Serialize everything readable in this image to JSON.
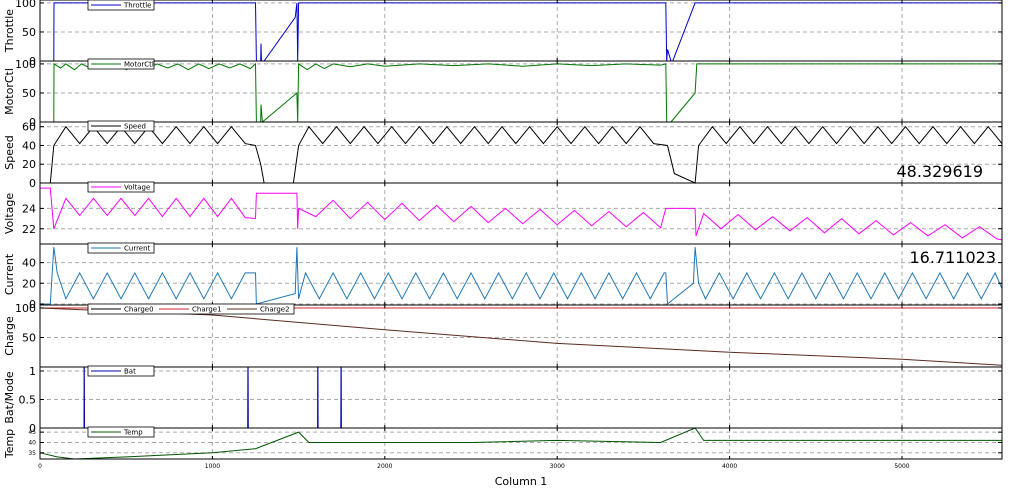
{
  "chart_data": {
    "type": "line",
    "xlabel": "Column 1",
    "xlim": [
      0,
      5580
    ],
    "xticks": [
      {
        "v": 0,
        "label": "0"
      },
      {
        "v": 1000,
        "label": "1000"
      },
      {
        "v": 2000,
        "label": "2000"
      },
      {
        "v": 3000,
        "label": "3000"
      },
      {
        "v": 4000,
        "label": "4000"
      },
      {
        "v": 5000,
        "label": "5000"
      }
    ],
    "grid": true,
    "panels": [
      {
        "ylabel": "Throttle",
        "ylim": [
          0,
          105
        ],
        "yticks": [
          {
            "v": 0,
            "label": "0"
          },
          {
            "v": 50,
            "label": "50"
          },
          {
            "v": 100,
            "label": "100"
          }
        ],
        "series": [
          {
            "name": "Throttle",
            "color": "#0000cc",
            "x": [
              0,
              80,
              81,
              1250,
              1255,
              1280,
              1282,
              1285,
              1290,
              1300,
              1480,
              1490,
              1495,
              1500,
              3630,
              3635,
              3640,
              3660,
              3670,
              3800,
              5580
            ],
            "y": [
              0,
              0,
              100,
              100,
              0,
              0,
              30,
              0,
              0,
              0,
              75,
              100,
              0,
              100,
              100,
              0,
              20,
              0,
              0,
              100,
              100
            ]
          }
        ]
      },
      {
        "ylabel": "MotorCtl",
        "ylim": [
          0,
          105
        ],
        "yticks": [
          {
            "v": 0,
            "label": "0"
          },
          {
            "v": 50,
            "label": "50"
          },
          {
            "v": 100,
            "label": "100"
          }
        ],
        "series": [
          {
            "name": "MotorCtl",
            "color": "#007700",
            "x": [
              0,
              80,
              81,
              120,
              150,
              200,
              240,
              300,
              350,
              400,
              450,
              500,
              560,
              620,
              680,
              740,
              800,
              860,
              920,
              980,
              1040,
              1100,
              1160,
              1220,
              1250,
              1255,
              1280,
              1282,
              1290,
              1490,
              1495,
              1500,
              1550,
              1600,
              1650,
              1700,
              1800,
              1900,
              2000,
              2200,
              2400,
              2600,
              2800,
              3000,
              3200,
              3400,
              3600,
              3630,
              3635,
              3660,
              3800,
              3810,
              4000,
              4500,
              5000,
              5580
            ],
            "y": [
              0,
              0,
              100,
              93,
              100,
              90,
              100,
              92,
              100,
              94,
              100,
              90,
              100,
              92,
              100,
              93,
              100,
              90,
              100,
              92,
              100,
              93,
              100,
              92,
              100,
              0,
              0,
              30,
              0,
              50,
              0,
              100,
              90,
              100,
              92,
              100,
              95,
              100,
              96,
              100,
              97,
              100,
              96,
              100,
              97,
              100,
              98,
              100,
              0,
              0,
              50,
              100,
              100,
              100,
              100,
              100
            ]
          }
        ]
      },
      {
        "ylabel": "Speed",
        "ylim": [
          0,
          65
        ],
        "yticks": [
          {
            "v": 0,
            "label": "0"
          },
          {
            "v": 20,
            "label": "20"
          },
          {
            "v": 40,
            "label": "40"
          },
          {
            "v": 60,
            "label": "60"
          }
        ],
        "series": [
          {
            "name": "Speed",
            "color": "#000000",
            "x": [
              0,
              60,
              80,
              150,
              230,
              310,
              390,
              470,
              550,
              630,
              710,
              790,
              870,
              950,
              1030,
              1110,
              1190,
              1250,
              1280,
              1300,
              1470,
              1500,
              1560,
              1640,
              1720,
              1800,
              1880,
              1960,
              2040,
              2120,
              2200,
              2280,
              2360,
              2440,
              2520,
              2600,
              2680,
              2760,
              2840,
              2920,
              3000,
              3080,
              3160,
              3240,
              3320,
              3400,
              3480,
              3560,
              3640,
              3680,
              3800,
              3820,
              3900,
              3980,
              4060,
              4140,
              4220,
              4300,
              4380,
              4460,
              4540,
              4620,
              4700,
              4780,
              4860,
              4940,
              5020,
              5100,
              5180,
              5260,
              5340,
              5420,
              5500,
              5580
            ],
            "y": [
              0,
              0,
              40,
              60,
              42,
              60,
              42,
              60,
              42,
              60,
              42,
              60,
              42,
              60,
              42,
              60,
              42,
              40,
              20,
              0,
              0,
              40,
              60,
              42,
              60,
              42,
              60,
              42,
              60,
              42,
              60,
              42,
              60,
              42,
              60,
              42,
              60,
              42,
              60,
              42,
              60,
              42,
              60,
              42,
              60,
              42,
              60,
              42,
              40,
              10,
              0,
              40,
              60,
              42,
              60,
              42,
              60,
              42,
              60,
              42,
              60,
              42,
              60,
              42,
              60,
              42,
              60,
              42,
              60,
              42,
              60,
              42,
              60,
              42
            ]
          }
        ],
        "annotation": "48.329619"
      },
      {
        "ylabel": "Voltage",
        "ylim": [
          20.5,
          26.5
        ],
        "yticks": [
          {
            "v": 22,
            "label": "22"
          },
          {
            "v": 24,
            "label": "24"
          }
        ],
        "series": [
          {
            "name": "Voltage",
            "color": "#ff00ff",
            "x": [
              0,
              60,
              80,
              150,
              230,
              310,
              390,
              470,
              550,
              630,
              710,
              790,
              870,
              950,
              1030,
              1110,
              1190,
              1250,
              1255,
              1490,
              1495,
              1500,
              1600,
              1700,
              1800,
              1900,
              2000,
              2100,
              2200,
              2300,
              2400,
              2500,
              2600,
              2700,
              2800,
              2900,
              3000,
              3100,
              3200,
              3300,
              3400,
              3500,
              3600,
              3630,
              3635,
              3800,
              3805,
              3850,
              3950,
              4050,
              4150,
              4250,
              4350,
              4450,
              4550,
              4650,
              4750,
              4850,
              4950,
              5050,
              5150,
              5250,
              5350,
              5450,
              5550,
              5580
            ],
            "y": [
              26,
              26,
              22,
              25,
              23.3,
              25,
              23.3,
              25,
              23.3,
              25,
              23.2,
              25,
              23.2,
              25,
              23.2,
              25,
              23.1,
              23,
              25.5,
              25.5,
              22,
              24,
              23.2,
              24.8,
              23,
              24.6,
              22.9,
              24.5,
              22.8,
              24.3,
              22.7,
              24.2,
              22.6,
              24,
              22.5,
              23.9,
              22.4,
              23.8,
              22.3,
              23.7,
              22.2,
              23.6,
              22.1,
              24,
              24,
              24,
              21.3,
              23.5,
              22,
              23.4,
              21.9,
              23.2,
              21.8,
              23.1,
              21.6,
              23,
              21.5,
              22.8,
              21.4,
              22.6,
              21.3,
              22.4,
              21.1,
              22.2,
              21,
              20.9
            ]
          }
        ]
      },
      {
        "ylabel": "Current",
        "ylim": [
          -1,
          58
        ],
        "yticks": [
          {
            "v": 0,
            "label": "0"
          },
          {
            "v": 20,
            "label": "20"
          },
          {
            "v": 40,
            "label": "40"
          }
        ],
        "series": [
          {
            "name": "Current",
            "color": "#1f77b4",
            "x": [
              0,
              60,
              80,
              100,
              150,
              230,
              310,
              390,
              470,
              550,
              630,
              710,
              790,
              870,
              950,
              1030,
              1110,
              1190,
              1250,
              1255,
              1480,
              1490,
              1500,
              1540,
              1620,
              1700,
              1780,
              1860,
              1940,
              2020,
              2100,
              2180,
              2260,
              2340,
              2420,
              2500,
              2580,
              2660,
              2740,
              2820,
              2900,
              2980,
              3060,
              3140,
              3220,
              3300,
              3380,
              3460,
              3540,
              3620,
              3630,
              3640,
              3790,
              3800,
              3820,
              3860,
              3940,
              4020,
              4100,
              4180,
              4260,
              4340,
              4420,
              4500,
              4580,
              4660,
              4740,
              4820,
              4900,
              4980,
              5060,
              5140,
              5220,
              5300,
              5380,
              5460,
              5540,
              5580
            ],
            "y": [
              0,
              0,
              55,
              30,
              5,
              30,
              5,
              30,
              5,
              30,
              5,
              30,
              5,
              30,
              5,
              30,
              5,
              30,
              30,
              0,
              10,
              55,
              5,
              30,
              5,
              30,
              5,
              30,
              5,
              30,
              5,
              30,
              5,
              30,
              5,
              30,
              5,
              30,
              5,
              30,
              5,
              30,
              5,
              30,
              5,
              30,
              5,
              30,
              5,
              30,
              30,
              0,
              20,
              55,
              20,
              5,
              30,
              5,
              30,
              5,
              30,
              5,
              30,
              5,
              30,
              5,
              30,
              5,
              30,
              5,
              30,
              5,
              30,
              5,
              30,
              5,
              30,
              15
            ]
          }
        ],
        "annotation": "16.711023"
      },
      {
        "ylabel": "Charge",
        "ylim": [
          0,
          105
        ],
        "yticks": [
          {
            "v": 50,
            "label": "50"
          },
          {
            "v": 100,
            "label": "100"
          }
        ],
        "series": [
          {
            "name": "Charge0",
            "color": "#000000",
            "x": [
              0,
              5580
            ],
            "y": [
              100,
              100
            ]
          },
          {
            "name": "Charge1",
            "color": "#d62728",
            "x": [
              0,
              5580
            ],
            "y": [
              100,
              100
            ]
          },
          {
            "name": "Charge2",
            "color": "#5c2a1e",
            "x": [
              0,
              1000,
              2000,
              3000,
              4000,
              5000,
              5580
            ],
            "y": [
              100,
              88,
              63,
              40,
              25,
              13,
              3
            ]
          }
        ]
      },
      {
        "ylabel": "Bat/Mode",
        "ylim": [
          0,
          1.07
        ],
        "yticks": [
          {
            "v": 0,
            "label": "0"
          },
          {
            "v": 0.5,
            "label": "0.5"
          },
          {
            "v": 1,
            "label": "1"
          }
        ],
        "series": [
          {
            "name": "Bat",
            "color": "#0000aa",
            "x": [
              0,
              255,
              256,
              257,
              258,
              1205,
              1206,
              1207,
              1208,
              1610,
              1611,
              1612,
              1613,
              1745,
              1746,
              1747,
              1748,
              5580
            ],
            "y": [
              0,
              0,
              1.07,
              1.07,
              0,
              0,
              1.07,
              1.07,
              0,
              0,
              1.07,
              1.07,
              0,
              0,
              1.07,
              1.07,
              0,
              0
            ]
          }
        ]
      },
      {
        "ylabel": "Temp",
        "ylim": [
          32,
          47
        ],
        "yticks": [
          {
            "v": 35,
            "label": "35"
          },
          {
            "v": 40,
            "label": "40"
          },
          {
            "v": 45,
            "label": "45"
          }
        ],
        "series": [
          {
            "name": "Temp",
            "color": "#005500",
            "x": [
              0,
              100,
              200,
              500,
              1000,
              1250,
              1500,
              1560,
              1800,
              2500,
              3000,
              3600,
              3800,
              3850,
              4200,
              5000,
              5580
            ],
            "y": [
              35,
              33,
              32,
              33,
              35,
              37,
              45,
              40,
              40,
              40,
              41,
              40,
              47,
              41,
              41,
              41,
              41
            ]
          }
        ]
      }
    ]
  }
}
